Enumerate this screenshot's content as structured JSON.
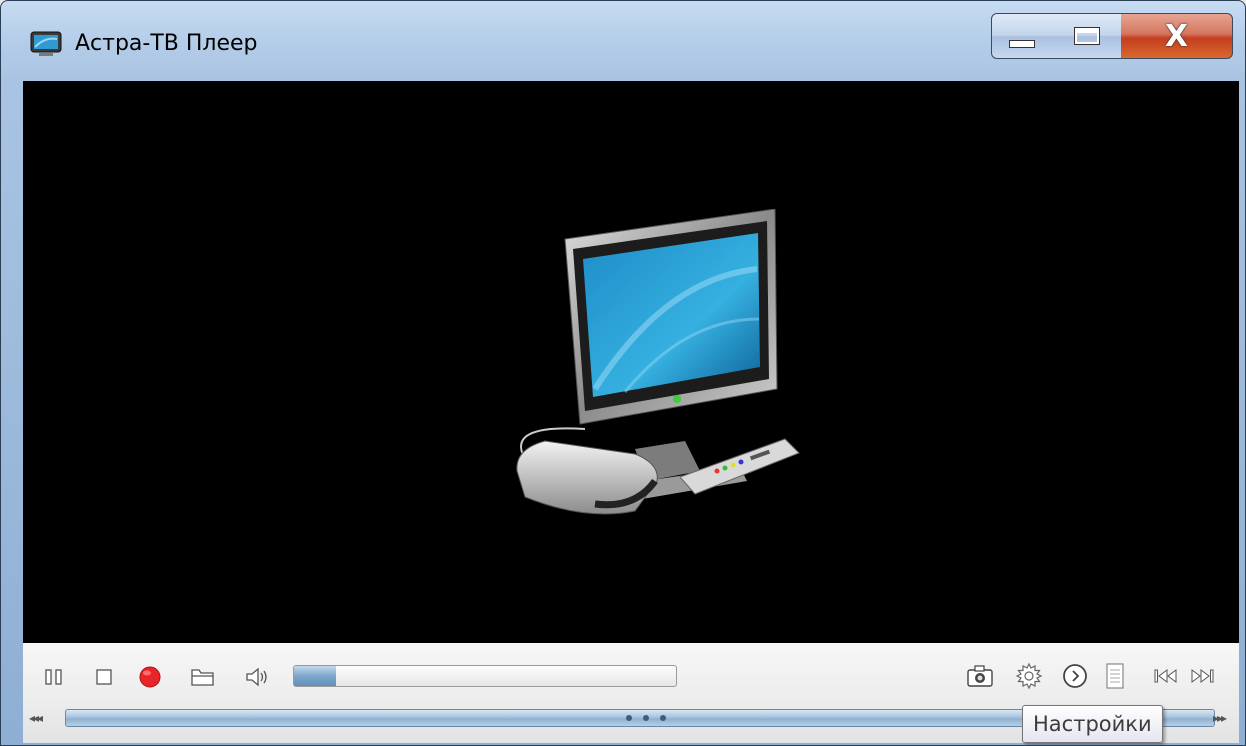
{
  "window": {
    "title": "Астра-ТВ Плеер",
    "icon": "tv-app-icon",
    "caption_buttons": {
      "minimize": "minimize-icon",
      "maximize": "maximize-icon",
      "close_glyph": "X"
    }
  },
  "video": {
    "placeholder_art": "tv-set-with-settop-box-and-remote"
  },
  "controls": {
    "left": [
      {
        "name": "pause-button",
        "icon": "pause-icon"
      },
      {
        "name": "stop-button",
        "icon": "stop-icon"
      },
      {
        "name": "record-button",
        "icon": "record-icon"
      },
      {
        "name": "open-file-button",
        "icon": "folder-icon"
      },
      {
        "name": "mute-button",
        "icon": "speaker-icon"
      }
    ],
    "volume_level": 0.11,
    "right": [
      {
        "name": "snapshot-button",
        "icon": "camera-icon"
      },
      {
        "name": "settings-button",
        "icon": "gear-icon"
      },
      {
        "name": "next-channel-button",
        "icon": "circle-chevron-right-icon"
      },
      {
        "name": "playlist-button",
        "icon": "list-icon"
      },
      {
        "name": "previous-track-button",
        "icon": "skip-back-icon"
      },
      {
        "name": "next-track-button",
        "icon": "skip-forward-icon"
      }
    ],
    "seek": {
      "back_glyph": "◂◂◂",
      "forward_glyph": "▸▸▸"
    }
  },
  "tooltip": {
    "text": "Настройки"
  },
  "colors": {
    "record": "#e8262a",
    "video_bg": "#000000",
    "accent": "#5f8fbd"
  }
}
